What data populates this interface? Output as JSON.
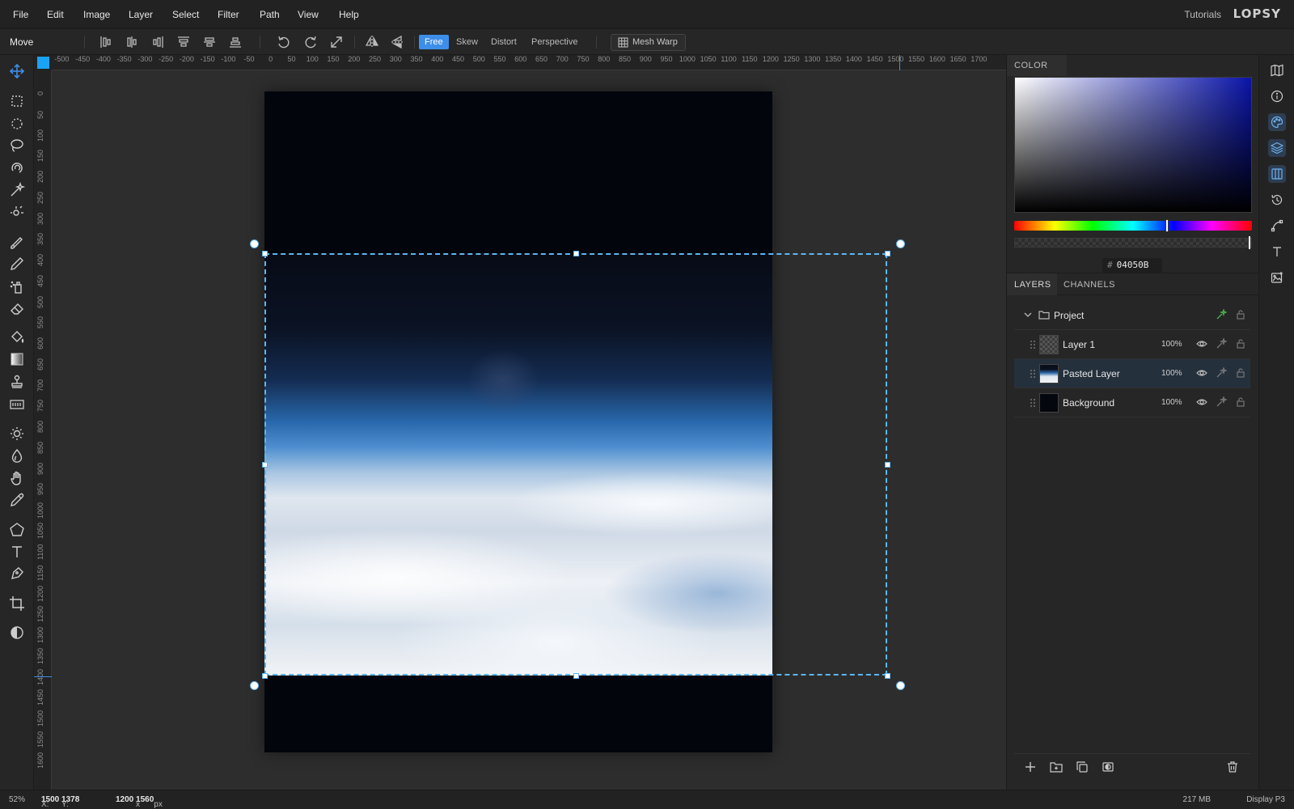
{
  "menu": [
    "File",
    "Edit",
    "Image",
    "Layer",
    "Select",
    "Filter",
    "Path",
    "View",
    "Help"
  ],
  "header_right": {
    "tutorials": "Tutorials",
    "logo": "LOPSY"
  },
  "options": {
    "tool_name": "Move",
    "transform_modes": [
      "Free",
      "Skew",
      "Distort",
      "Perspective"
    ],
    "active_mode": "Free",
    "mesh_warp": "Mesh Warp"
  },
  "rulers": {
    "top": [
      "-500",
      "-450",
      "-400",
      "-350",
      "-300",
      "-250",
      "-200",
      "-150",
      "-100",
      "-50",
      "0",
      "50",
      "100",
      "150",
      "200",
      "250",
      "300",
      "350",
      "400",
      "450",
      "500",
      "550",
      "600",
      "650",
      "700",
      "750",
      "800",
      "850",
      "900",
      "950",
      "1000",
      "1050",
      "1100",
      "1150",
      "1200",
      "1250",
      "1300",
      "1350",
      "1400",
      "1450",
      "1500",
      "1550",
      "1600",
      "1650",
      "1700"
    ],
    "left": [
      "0",
      "50",
      "100",
      "150",
      "200",
      "250",
      "300",
      "350",
      "400",
      "450",
      "500",
      "550",
      "600",
      "650",
      "700",
      "750",
      "800",
      "850",
      "900",
      "950",
      "1000",
      "1050",
      "1100",
      "1150",
      "1200",
      "1250",
      "1300",
      "1350",
      "1400",
      "1450",
      "1500",
      "1550",
      "1600"
    ]
  },
  "color_panel": {
    "title": "COLOR",
    "hex_prefix": "#",
    "hex": "04050B"
  },
  "layers_panel": {
    "tabs": [
      "LAYERS",
      "CHANNELS"
    ],
    "group": "Project",
    "layers": [
      {
        "name": "Layer 1",
        "opacity": "100%"
      },
      {
        "name": "Pasted Layer",
        "opacity": "100%"
      },
      {
        "name": "Background",
        "opacity": "100%"
      }
    ]
  },
  "status": {
    "zoom": "52%",
    "x_label": "X:",
    "x": "1500",
    "y_label": "Y:",
    "y": "1378",
    "width": "1200",
    "times": "x",
    "height": "1560",
    "unit": "px",
    "memory": "217 MB",
    "profile": "Display P3"
  },
  "colors": {
    "accent": "#3d8ee8",
    "selection": "#5fb6f0",
    "corner": "#1aa3f5"
  }
}
